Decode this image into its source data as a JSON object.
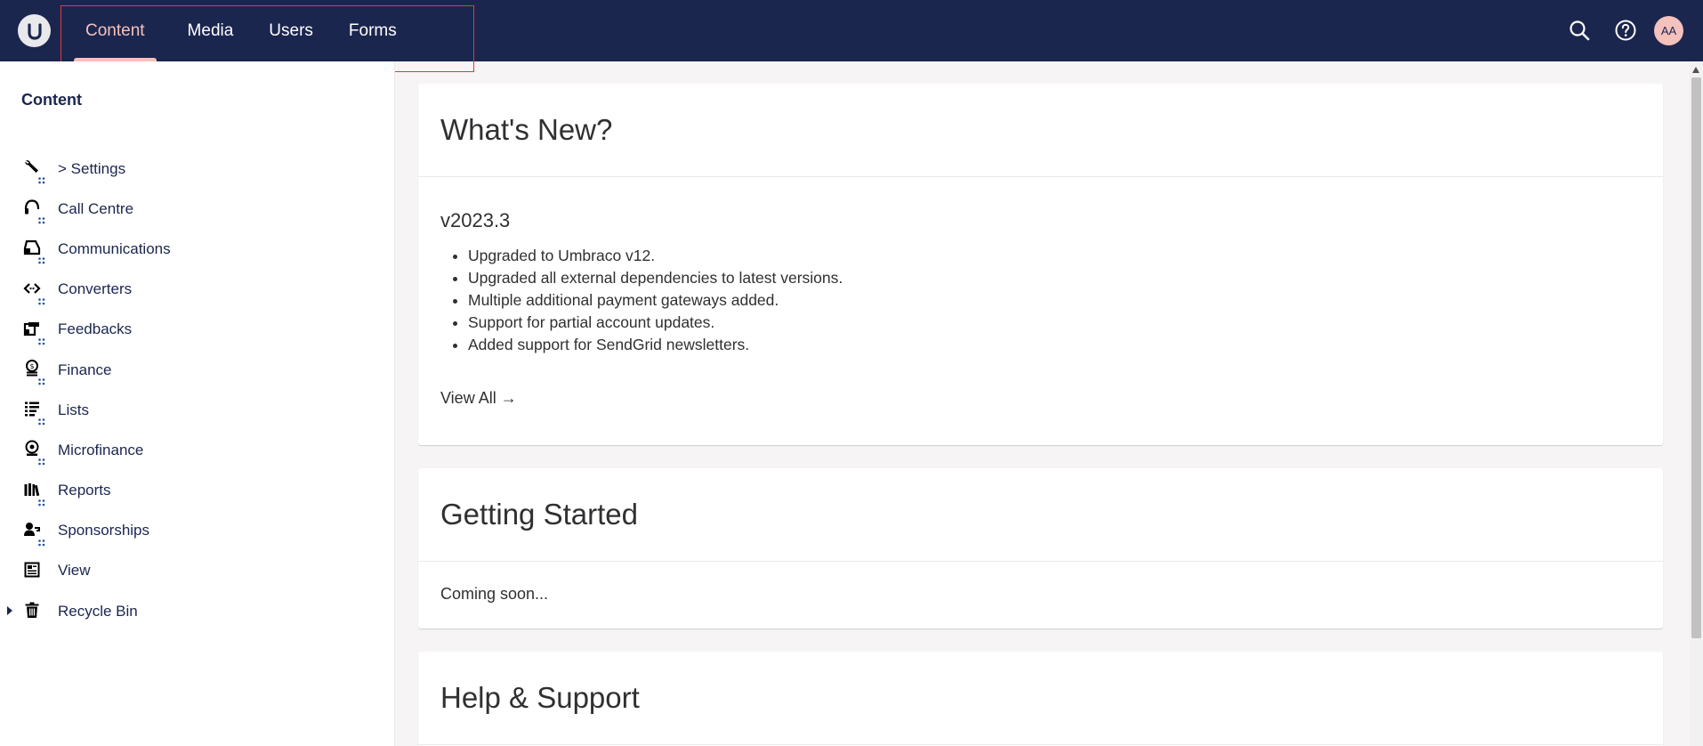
{
  "header": {
    "logo_alt": "Umbraco",
    "sections": [
      {
        "label": "Content",
        "active": true
      },
      {
        "label": "Media",
        "active": false
      },
      {
        "label": "Users",
        "active": false
      },
      {
        "label": "Forms",
        "active": false
      }
    ],
    "search_icon": "search-icon",
    "help_icon": "help-icon",
    "avatar_initials": "AA",
    "colors": {
      "bar": "#1b264f",
      "active": "#f5c1bc",
      "highlight": "#e5373f"
    }
  },
  "sidebar": {
    "title": "Content",
    "items": [
      {
        "label": "> Settings",
        "icon": "wrench-icon"
      },
      {
        "label": "Call Centre",
        "icon": "headset-icon"
      },
      {
        "label": "Communications",
        "icon": "inbox-icon"
      },
      {
        "label": "Converters",
        "icon": "code-arrows-icon"
      },
      {
        "label": "Feedbacks",
        "icon": "feedback-icon"
      },
      {
        "label": "Finance",
        "icon": "coins-icon"
      },
      {
        "label": "Lists",
        "icon": "list-icon"
      },
      {
        "label": "Microfinance",
        "icon": "coin-icon"
      },
      {
        "label": "Reports",
        "icon": "books-icon"
      },
      {
        "label": "Sponsorships",
        "icon": "user-icon"
      },
      {
        "label": "View",
        "icon": "newspaper-icon"
      },
      {
        "label": "Recycle Bin",
        "icon": "trash-icon"
      }
    ]
  },
  "main": {
    "whats_new": {
      "title": "What's New?",
      "version": "v2023.3",
      "changes": [
        "Upgraded to Umbraco v12.",
        "Upgraded all external dependencies to latest versions.",
        "Multiple additional payment gateways added.",
        "Support for partial account updates.",
        "Added support for SendGrid newsletters."
      ],
      "view_all": "View All →"
    },
    "getting_started": {
      "title": "Getting Started",
      "text": "Coming soon..."
    },
    "help_support": {
      "title": "Help & Support"
    }
  }
}
